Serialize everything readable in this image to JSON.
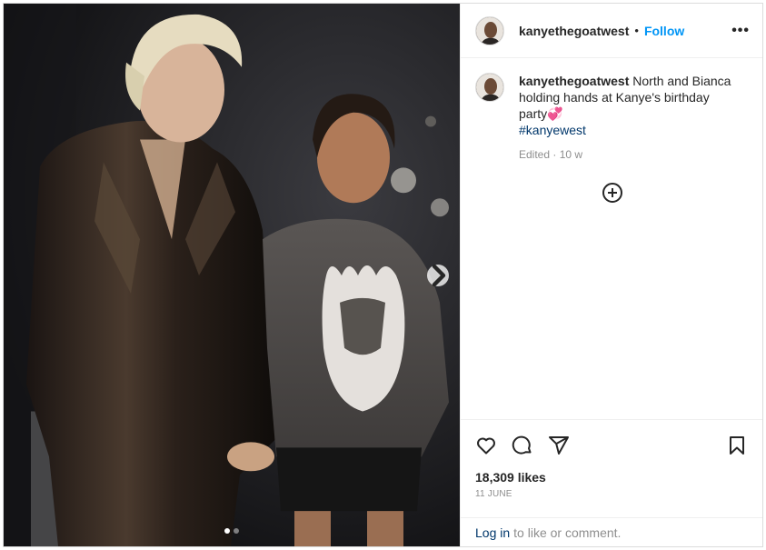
{
  "post": {
    "username": "kanyethegoatwest",
    "separator": "•",
    "follow_label": "Follow",
    "more_label": "•••",
    "caption_text": "North and Bianca holding hands at Kanye's birthday party💞",
    "hashtag": "#kanyewest",
    "edited_label": "Edited · 10 w",
    "likes": "18,309 likes",
    "date": "11 JUNE",
    "login_link": "Log in",
    "login_rest": "to like or comment."
  },
  "carousel": {
    "current": 1,
    "total": 2
  },
  "icons": {
    "next": "chevron-right-icon",
    "like": "heart-icon",
    "comment": "comment-icon",
    "share": "paper-plane-icon",
    "save": "bookmark-icon",
    "add": "add-circle-icon",
    "more": "more-icon"
  },
  "colors": {
    "follow": "#0095f6",
    "hashtag": "#00376b",
    "muted": "#8e8e8e",
    "border": "#dbdbdb"
  }
}
